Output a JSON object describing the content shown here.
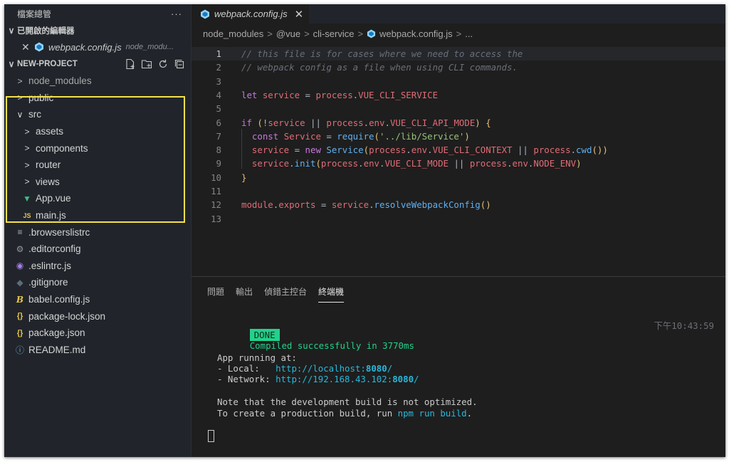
{
  "sidebar": {
    "title": "檔案總管",
    "more": "···",
    "open_editors_label": "已開啟的編輯器",
    "open_editor": {
      "name": "webpack.config.js",
      "path": "node_modu..."
    },
    "project_label": "NEW-PROJECT",
    "tree": [
      {
        "label": "node_modules",
        "icon": "chevron-right-icon",
        "glyph": ">",
        "depth": 0,
        "color": "#b9b9b9"
      },
      {
        "label": "public",
        "icon": "chevron-right-icon",
        "glyph": ">",
        "depth": 0,
        "color": "#d4d4d4"
      },
      {
        "label": "src",
        "icon": "chevron-down-icon",
        "glyph": "∨",
        "depth": 0,
        "color": "#d4d4d4"
      },
      {
        "label": "assets",
        "icon": "chevron-right-icon",
        "glyph": ">",
        "depth": 1,
        "color": "#d4d4d4"
      },
      {
        "label": "components",
        "icon": "chevron-right-icon",
        "glyph": ">",
        "depth": 1,
        "color": "#d4d4d4"
      },
      {
        "label": "router",
        "icon": "chevron-right-icon",
        "glyph": ">",
        "depth": 1,
        "color": "#d4d4d4"
      },
      {
        "label": "views",
        "icon": "chevron-right-icon",
        "glyph": ">",
        "depth": 1,
        "color": "#d4d4d4"
      },
      {
        "label": "App.vue",
        "icon": "vue-icon",
        "glyph": "▼",
        "depth": 1,
        "color": "#41b883"
      },
      {
        "label": "main.js",
        "icon": "js-file-icon",
        "glyph": "JS",
        "depth": 1,
        "color": "#e8c547"
      },
      {
        "label": ".browserslistrc",
        "icon": "list-file-icon",
        "glyph": "≡",
        "depth": 0,
        "color": "#b0b0b0"
      },
      {
        "label": ".editorconfig",
        "icon": "gear-icon",
        "glyph": "⚙",
        "depth": 0,
        "color": "#9a9a9a"
      },
      {
        "label": ".eslintrc.js",
        "icon": "eslint-icon",
        "glyph": "◉",
        "depth": 0,
        "color": "#a67ee8"
      },
      {
        "label": ".gitignore",
        "icon": "git-icon",
        "glyph": "◆",
        "depth": 0,
        "color": "#5a6e7a"
      },
      {
        "label": "babel.config.js",
        "icon": "babel-icon",
        "glyph": "B",
        "depth": 0,
        "color": "#e8c547"
      },
      {
        "label": "package-lock.json",
        "icon": "json-icon",
        "glyph": "{}",
        "depth": 0,
        "color": "#e8c547"
      },
      {
        "label": "package.json",
        "icon": "json-icon",
        "glyph": "{}",
        "depth": 0,
        "color": "#e8c547"
      },
      {
        "label": "README.md",
        "icon": "info-icon",
        "glyph": "ⓘ",
        "depth": 0,
        "color": "#6fa8dc"
      }
    ]
  },
  "editor": {
    "tab": {
      "name": "webpack.config.js",
      "close": "✕"
    },
    "breadcrumb": [
      "node_modules",
      "@vue",
      "cli-service",
      "webpack.config.js",
      "..."
    ],
    "lines": [
      [
        [
          "// this file is for cases where we need to access the",
          "c-cmt"
        ]
      ],
      [
        [
          "// webpack config as a file when using CLI commands.",
          "c-cmt"
        ]
      ],
      [],
      [
        [
          "let ",
          "c-kw"
        ],
        [
          "service",
          "c-var"
        ],
        [
          " = ",
          "c-pun"
        ],
        [
          "process",
          "c-var"
        ],
        [
          ".",
          "c-pun"
        ],
        [
          "VUE_CLI_SERVICE",
          "c-var"
        ]
      ],
      [],
      [
        [
          "if ",
          "c-kw"
        ],
        [
          "(",
          "c-br"
        ],
        [
          "!",
          "c-pun"
        ],
        [
          "service",
          "c-var"
        ],
        [
          " || ",
          "c-pun"
        ],
        [
          "process",
          "c-var"
        ],
        [
          ".",
          "c-pun"
        ],
        [
          "env",
          "c-var"
        ],
        [
          ".",
          "c-pun"
        ],
        [
          "VUE_CLI_API_MODE",
          "c-var"
        ],
        [
          ") ",
          "c-br"
        ],
        [
          "{",
          "c-br"
        ]
      ],
      [
        [
          "  ",
          ""
        ],
        [
          "const ",
          "c-kw"
        ],
        [
          "Service",
          "c-var"
        ],
        [
          " = ",
          "c-pun"
        ],
        [
          "require",
          "c-fn"
        ],
        [
          "(",
          "c-br"
        ],
        [
          "'../lib/Service'",
          "c-str"
        ],
        [
          ")",
          "c-br"
        ]
      ],
      [
        [
          "  ",
          ""
        ],
        [
          "service",
          "c-var"
        ],
        [
          " = ",
          "c-pun"
        ],
        [
          "new ",
          "c-kw"
        ],
        [
          "Service",
          "c-fn"
        ],
        [
          "(",
          "c-br"
        ],
        [
          "process",
          "c-var"
        ],
        [
          ".",
          "c-pun"
        ],
        [
          "env",
          "c-var"
        ],
        [
          ".",
          "c-pun"
        ],
        [
          "VUE_CLI_CONTEXT",
          "c-var"
        ],
        [
          " || ",
          "c-pun"
        ],
        [
          "process",
          "c-var"
        ],
        [
          ".",
          "c-pun"
        ],
        [
          "cwd",
          "c-fn"
        ],
        [
          "())",
          "c-br"
        ]
      ],
      [
        [
          "  ",
          ""
        ],
        [
          "service",
          "c-var"
        ],
        [
          ".",
          "c-pun"
        ],
        [
          "init",
          "c-fn"
        ],
        [
          "(",
          "c-br"
        ],
        [
          "process",
          "c-var"
        ],
        [
          ".",
          "c-pun"
        ],
        [
          "env",
          "c-var"
        ],
        [
          ".",
          "c-pun"
        ],
        [
          "VUE_CLI_MODE",
          "c-var"
        ],
        [
          " || ",
          "c-pun"
        ],
        [
          "process",
          "c-var"
        ],
        [
          ".",
          "c-pun"
        ],
        [
          "env",
          "c-var"
        ],
        [
          ".",
          "c-pun"
        ],
        [
          "NODE_ENV",
          "c-var"
        ],
        [
          ")",
          "c-br"
        ]
      ],
      [
        [
          "}",
          "c-br"
        ]
      ],
      [],
      [
        [
          "module",
          "c-var"
        ],
        [
          ".",
          "c-pun"
        ],
        [
          "exports",
          "c-var"
        ],
        [
          " = ",
          "c-pun"
        ],
        [
          "service",
          "c-var"
        ],
        [
          ".",
          "c-pun"
        ],
        [
          "resolveWebpackConfig",
          "c-fn"
        ],
        [
          "()",
          "c-br"
        ]
      ],
      []
    ]
  },
  "panel": {
    "tabs": [
      "問題",
      "輸出",
      "偵錯主控台",
      "終端機"
    ],
    "active_tab": 3,
    "done_label": "DONE",
    "compiled": "Compiled successfully in 3770ms",
    "time": "下午10:43:59",
    "app_running": "App running at:",
    "local_label": "- Local:   ",
    "local_url": "http://localhost:",
    "local_port": "8080",
    "local_slash": "/",
    "network_label": "- Network: ",
    "network_url": "http://192.168.43.102:",
    "network_port": "8080",
    "network_slash": "/",
    "note1": "Note that the development build is not optimized.",
    "note2_pre": "To create a production build, run ",
    "note2_cmd": "npm run build",
    "note2_post": "."
  }
}
